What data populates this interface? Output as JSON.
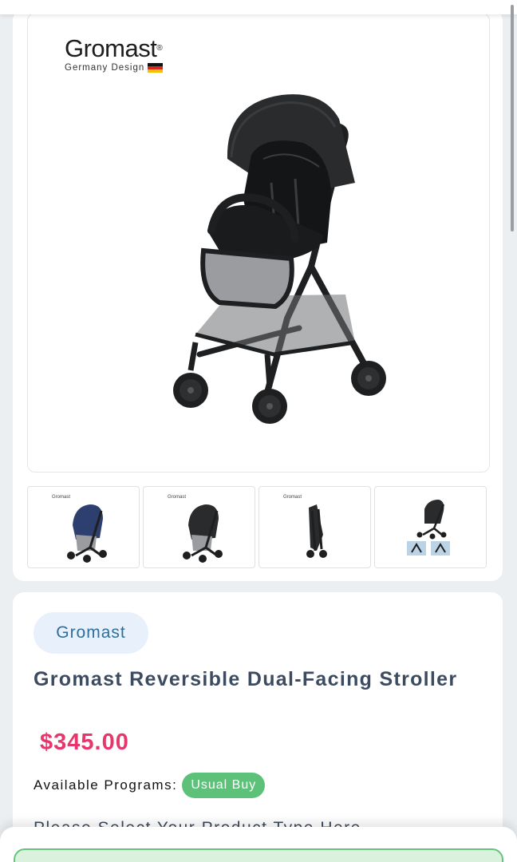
{
  "gallery": {
    "brand_logo": {
      "wordmark": "Gromast",
      "registered_mark": "®",
      "tagline": "Germany Design"
    },
    "main_image": {
      "subject": "black reversible stroller",
      "colors": {
        "frame": "#1e1f21",
        "canopy": "#2a2b2d",
        "mesh": "#9a9c9f"
      }
    },
    "thumbnails": [
      {
        "label": "navy stroller",
        "accent": "#2c3f6e"
      },
      {
        "label": "black stroller",
        "accent": "#2a2b2d"
      },
      {
        "label": "folded stroller",
        "accent": "#2a2b2d"
      },
      {
        "label": "stroller with detail views",
        "accent": "#2a2b2d"
      }
    ]
  },
  "product": {
    "brand_chip": "Gromast",
    "title": "Gromast Reversible Dual-Facing Stroller",
    "price": "$345.00",
    "programs_label": "Available Programs:",
    "program_badge": "Usual Buy",
    "type_prompt": "Please Select Your Product Type Here"
  },
  "colors": {
    "price": "#e6366b",
    "badge": "#5ec17a",
    "chip_bg": "#e7f0fb",
    "chip_text": "#2f6f9c",
    "title": "#3d4b60"
  }
}
